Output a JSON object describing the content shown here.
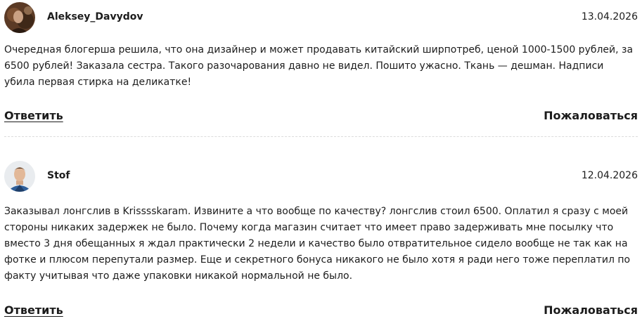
{
  "comments": [
    {
      "author": "Aleksey_Davydov",
      "date": "13.04.2026",
      "text": "Очередная блогерша решила, что она дизайнер и может продавать китайский ширпотреб, ценой 1000-1500 рублей, за 6500 рублей! Заказала сестра. Такого разочарования давно не видел. Пошито ужасно. Ткань — дешман. Надписи убила первая стирка на деликатке!",
      "reply_label": "Ответить",
      "report_label": "Пожаловаться"
    },
    {
      "author": "Stof",
      "date": "12.04.2026",
      "text": "Заказывал лонгслив в Krisssskaram. Извините а что вообще по качеству? лонгслив стоил 6500. Оплатил я сразу с моей стороны никаких задержек не было. Почему когда магазин считает что имеет право задерживать мне посылку что вместо 3 дня обещанных я ждал практически 2 недели и качество было отвратительное сидело вообще не так как на фотке и плюсом перепутали размер. Еще и секретного бонуса никакого не было хотя я ради него тоже переплатил по факту учитывая что даже упаковки никакой нормальной не было.",
      "reply_label": "Ответить",
      "report_label": "Пожаловаться"
    }
  ]
}
